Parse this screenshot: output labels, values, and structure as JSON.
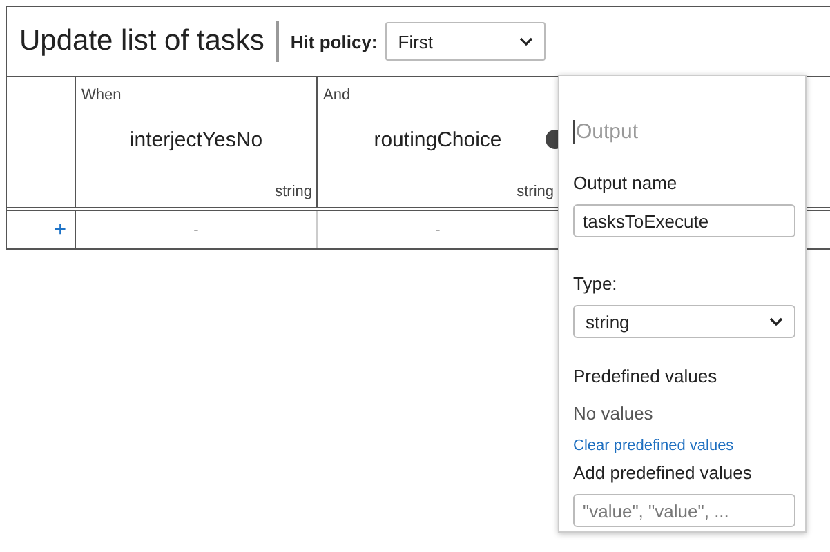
{
  "header": {
    "title": "Update list of tasks",
    "hit_policy_label": "Hit policy:",
    "hit_policy_value": "First"
  },
  "table": {
    "columns": [
      {
        "clause": "When",
        "name": "interjectYesNo",
        "type": "string"
      },
      {
        "clause": "And",
        "name": "routingChoice",
        "type": "string"
      }
    ],
    "rows": [
      {
        "add": "+",
        "cells": [
          "-",
          "-"
        ]
      }
    ]
  },
  "popup": {
    "label_placeholder": "Output",
    "output_name_label": "Output name",
    "output_name_value": "tasksToExecute",
    "type_label": "Type:",
    "type_value": "string",
    "predefined_heading": "Predefined values",
    "no_values": "No values",
    "clear_link": "Clear predefined values",
    "add_label": "Add predefined values",
    "add_placeholder": "\"value\", \"value\", ..."
  }
}
